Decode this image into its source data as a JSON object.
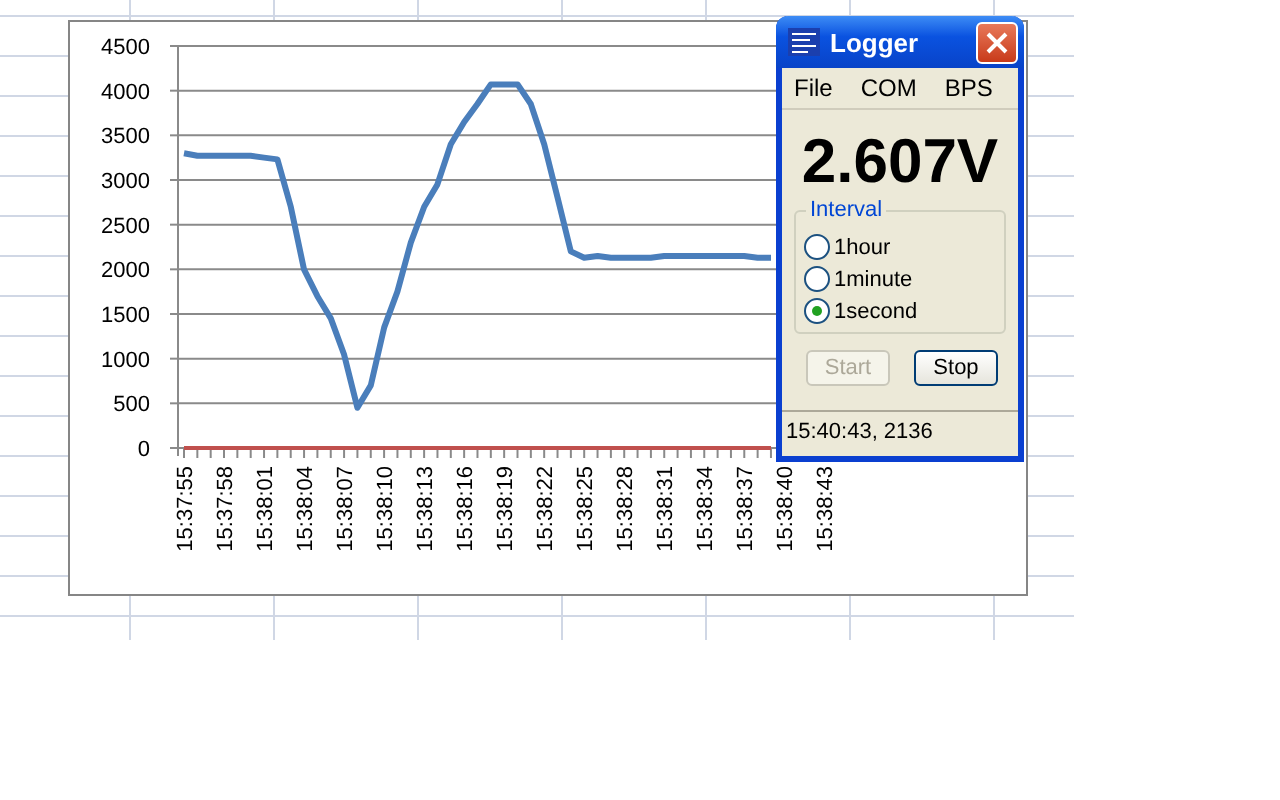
{
  "chart": {
    "chart_data": {
      "type": "line",
      "categories": [
        "15:37:55",
        null,
        null,
        "15:37:58",
        null,
        null,
        "15:38:01",
        null,
        null,
        "15:38:04",
        null,
        null,
        "15:38:07",
        null,
        null,
        "15:38:10",
        null,
        null,
        "15:38:13",
        null,
        null,
        "15:38:16",
        null,
        null,
        "15:38:19",
        null,
        null,
        "15:38:22",
        null,
        null,
        "15:38:25",
        null,
        null,
        "15:38:28",
        null,
        null,
        "15:38:31",
        null,
        null,
        "15:38:34",
        null,
        null,
        "15:38:37",
        null,
        null,
        "15:38:40",
        null,
        null,
        "15:38:43"
      ],
      "series": [
        {
          "color": "#4a7ebb",
          "values": [
            3300,
            3270,
            3270,
            3270,
            3270,
            3270,
            3250,
            3230,
            2700,
            2000,
            1700,
            1450,
            1050,
            450,
            700,
            1350,
            1750,
            2300,
            2700,
            2950,
            3400,
            3650,
            3850,
            4070,
            4070,
            4070,
            3850,
            3400,
            2800,
            2200,
            2130,
            2150,
            2130,
            2130,
            2130,
            2130,
            2150,
            2150,
            2150,
            2150,
            2150,
            2150,
            2150,
            2130,
            2130,
            null,
            null,
            null,
            null
          ]
        },
        {
          "color": "#c0504d",
          "values": [
            0,
            0,
            0,
            0,
            0,
            0,
            0,
            0,
            0,
            0,
            0,
            0,
            0,
            0,
            0,
            0,
            0,
            0,
            0,
            0,
            0,
            0,
            0,
            0,
            0,
            0,
            0,
            0,
            0,
            0,
            0,
            0,
            0,
            0,
            0,
            0,
            0,
            0,
            0,
            0,
            0,
            0,
            0,
            0,
            0,
            null,
            null,
            null,
            null
          ]
        }
      ],
      "grid": true,
      "ylim": [
        0,
        4500
      ],
      "yticks": [
        0,
        500,
        1000,
        1500,
        2000,
        2500,
        3000,
        3500,
        4000,
        4500
      ]
    }
  },
  "window": {
    "title": "Logger",
    "menu": [
      "File",
      "COM",
      "BPS"
    ],
    "reading": "2.607V",
    "group_title": "Interval",
    "radios": [
      {
        "label": "1hour",
        "selected": false
      },
      {
        "label": "1minute",
        "selected": false
      },
      {
        "label": "1second",
        "selected": true
      }
    ],
    "buttons": [
      {
        "label": "Start",
        "disabled": true
      },
      {
        "label": "Stop",
        "disabled": false
      }
    ],
    "status_bar": "15:40:43, 2136"
  }
}
